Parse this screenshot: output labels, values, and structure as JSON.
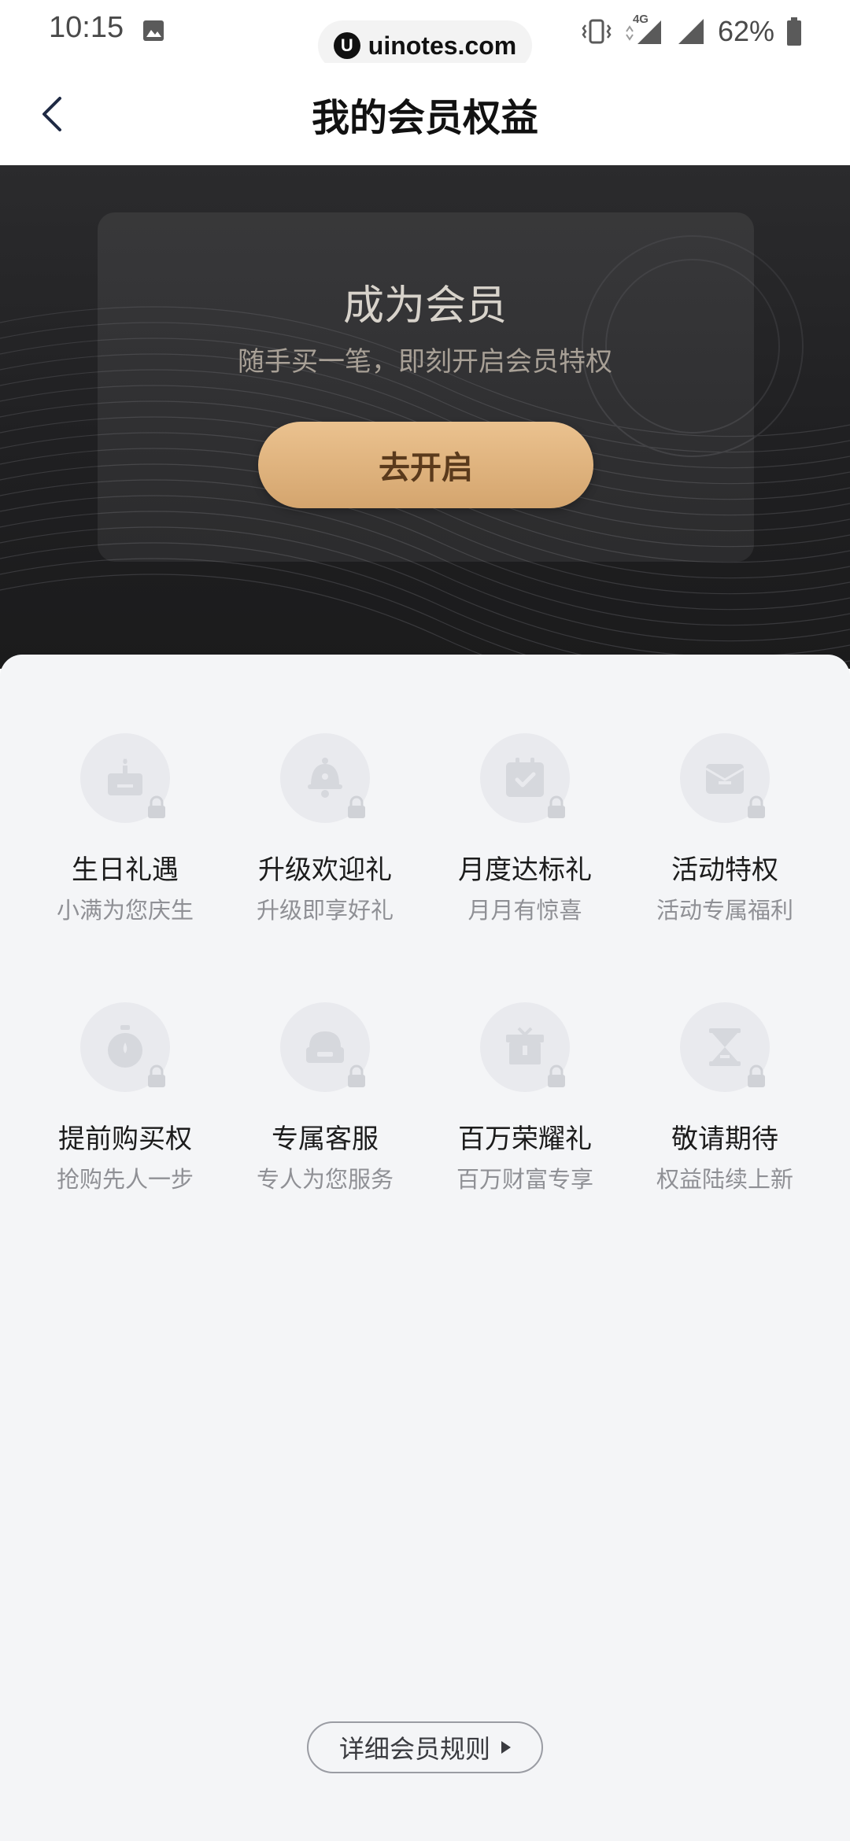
{
  "status_bar": {
    "time": "10:15",
    "battery": "62%",
    "network_type": "4G"
  },
  "watermark": {
    "logo_letter": "U",
    "text": "uinotes.com"
  },
  "header": {
    "title": "我的会员权益"
  },
  "hero": {
    "title": "成为会员",
    "subtitle": "随手买一笔，即刻开启会员特权",
    "button_label": "去开启"
  },
  "benefits": [
    {
      "title": "生日礼遇",
      "desc": "小满为您庆生",
      "icon": "cake-icon"
    },
    {
      "title": "升级欢迎礼",
      "desc": "升级即享好礼",
      "icon": "bell-icon"
    },
    {
      "title": "月度达标礼",
      "desc": "月月有惊喜",
      "icon": "calendar-check-icon"
    },
    {
      "title": "活动特权",
      "desc": "活动专属福利",
      "icon": "envelope-icon"
    },
    {
      "title": "提前购买权",
      "desc": "抢购先人一步",
      "icon": "stopwatch-icon"
    },
    {
      "title": "专属客服",
      "desc": "专人为您服务",
      "icon": "customer-service-icon"
    },
    {
      "title": "百万荣耀礼",
      "desc": "百万财富专享",
      "icon": "gift-icon"
    },
    {
      "title": "敬请期待",
      "desc": "权益陆续上新",
      "icon": "hourglass-icon"
    }
  ],
  "footer": {
    "rules_label": "详细会员规则"
  },
  "colors": {
    "accent_gold": "#d4a56e",
    "hero_dark": "#1f1f21",
    "panel_bg": "#f4f5f7",
    "icon_gray": "#d6d8dd"
  }
}
